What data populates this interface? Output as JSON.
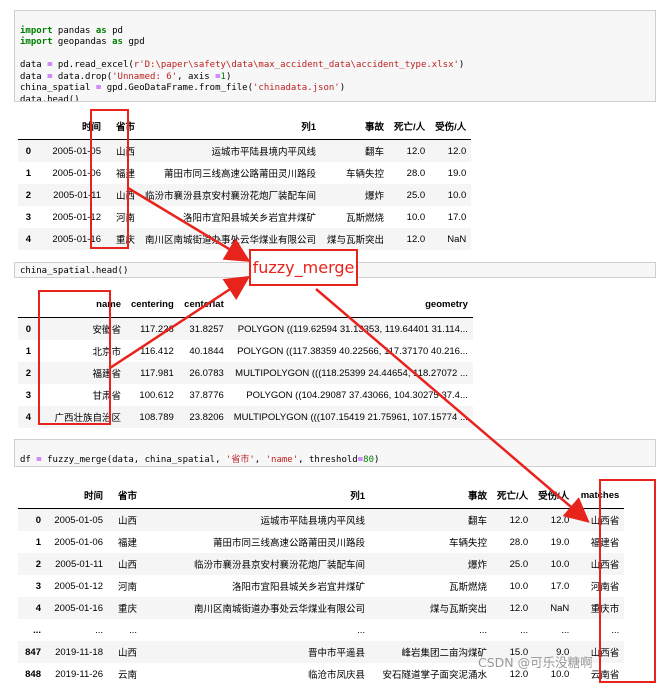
{
  "cell1": {
    "lines": [
      "import pandas as pd",
      "import geopandas as gpd",
      "",
      "data = pd.read_excel(r'D:\\paper\\safety\\data\\max_accident_data\\accident_type.xlsx')",
      "data = data.drop('Unnamed: 6', axis =1)",
      "china_spatial = gpd.GeoDataFrame.from_file('chinadata.json')",
      "data.head()"
    ]
  },
  "table1": {
    "columns": [
      "",
      "时间",
      "省市",
      "列1",
      "事故",
      "死亡/人",
      "受伤/人"
    ],
    "rows": [
      [
        "0",
        "2005-01-05",
        "山西",
        "运城市平陆县境内平风线",
        "翻车",
        "12.0",
        "12.0"
      ],
      [
        "1",
        "2005-01-06",
        "福建",
        "莆田市同三线高速公路莆田灵川路段",
        "车辆失控",
        "28.0",
        "19.0"
      ],
      [
        "2",
        "2005-01-11",
        "山西",
        "临汾市襄汾县京安村襄汾花炮厂装配车间",
        "爆炸",
        "25.0",
        "10.0"
      ],
      [
        "3",
        "2005-01-12",
        "河南",
        "洛阳市宜阳县城关乡岩宜井煤矿",
        "瓦斯燃烧",
        "10.0",
        "17.0"
      ],
      [
        "4",
        "2005-01-16",
        "重庆",
        "南川区南城街道办事处云华煤业有限公司",
        "煤与瓦斯突出",
        "12.0",
        "NaN"
      ]
    ]
  },
  "cell2": {
    "code": "china_spatial.head()"
  },
  "table2": {
    "columns": [
      "",
      "name",
      "centering",
      "centerlat",
      "geometry"
    ],
    "rows": [
      [
        "0",
        "安徽省",
        "117.226",
        "31.8257",
        "POLYGON ((119.62594 31.13353, 119.64401 31.114..."
      ],
      [
        "1",
        "北京市",
        "116.412",
        "40.1844",
        "POLYGON ((117.38359 40.22566, 117.37170 40.216..."
      ],
      [
        "2",
        "福建省",
        "117.981",
        "26.0783",
        "MULTIPOLYGON (((118.25399 24.44654, 118.27072 ..."
      ],
      [
        "3",
        "甘肃省",
        "100.612",
        "37.8776",
        "POLYGON ((104.29087 37.43066, 104.30275 37.4..."
      ],
      [
        "4",
        "广西壮族自治区",
        "108.789",
        "23.8206",
        "MULTIPOLYGON (((107.15419 21.75961, 107.15774 ..."
      ]
    ]
  },
  "cell3": {
    "lines": [
      "df = fuzzy_merge(data, china_spatial, '省市', 'name', threshold=80)",
      "df"
    ]
  },
  "table3": {
    "columns": [
      "",
      "时间",
      "省市",
      "列1",
      "事故",
      "死亡/人",
      "受伤/人",
      "matches"
    ],
    "rows": [
      [
        "0",
        "2005-01-05",
        "山西",
        "运城市平陆县境内平风线",
        "翻车",
        "12.0",
        "12.0",
        "山西省"
      ],
      [
        "1",
        "2005-01-06",
        "福建",
        "莆田市同三线高速公路莆田灵川路段",
        "车辆失控",
        "28.0",
        "19.0",
        "福建省"
      ],
      [
        "2",
        "2005-01-11",
        "山西",
        "临汾市襄汾县京安村襄汾花炮厂装配车间",
        "爆炸",
        "25.0",
        "10.0",
        "山西省"
      ],
      [
        "3",
        "2005-01-12",
        "河南",
        "洛阳市宜阳县城关乡岩宜井煤矿",
        "瓦斯燃烧",
        "10.0",
        "17.0",
        "河南省"
      ],
      [
        "4",
        "2005-01-16",
        "重庆",
        "南川区南城街道办事处云华煤业有限公司",
        "煤与瓦斯突出",
        "12.0",
        "NaN",
        "重庆市"
      ],
      [
        "...",
        "...",
        "...",
        "...",
        "...",
        "...",
        "...",
        "..."
      ],
      [
        "847",
        "2019-11-18",
        "山西",
        "晋中市平遥县",
        "峰岩集团二亩沟煤矿",
        "15.0",
        "9.0",
        "山西省"
      ],
      [
        "848",
        "2019-11-26",
        "云南",
        "临沧市凤庆县",
        "安石隧道掌子面突泥涌水",
        "12.0",
        "10.0",
        "云南省"
      ]
    ]
  },
  "annotation": {
    "label": "fuzzy_merge",
    "color": "#e8231c"
  },
  "watermark": "CSDN @可乐没糖啊"
}
